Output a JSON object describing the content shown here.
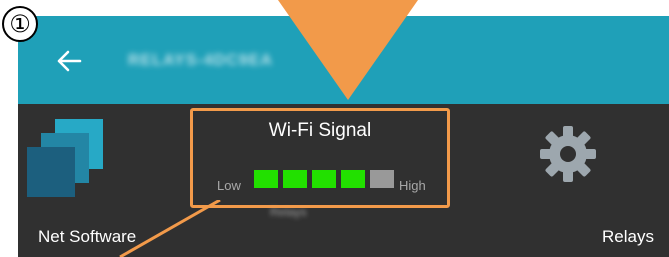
{
  "step": {
    "number": "①"
  },
  "appbar": {
    "title": "RELAYS-4DC9EA"
  },
  "tiles": {
    "left": {
      "label": "Net Software",
      "icon": "net-software-icon"
    },
    "right": {
      "label": "Relays",
      "icon": "gear-icon"
    },
    "center_caption": "Relays"
  },
  "wifi": {
    "title": "Wi-Fi Signal",
    "low_label": "Low",
    "high_label": "High",
    "strength": 4,
    "max": 5,
    "active_color": "#22e000",
    "inactive_color": "#999999"
  },
  "colors": {
    "appbar": "#1fa0b8",
    "panel": "#303030",
    "highlight": "#f29a4a"
  }
}
